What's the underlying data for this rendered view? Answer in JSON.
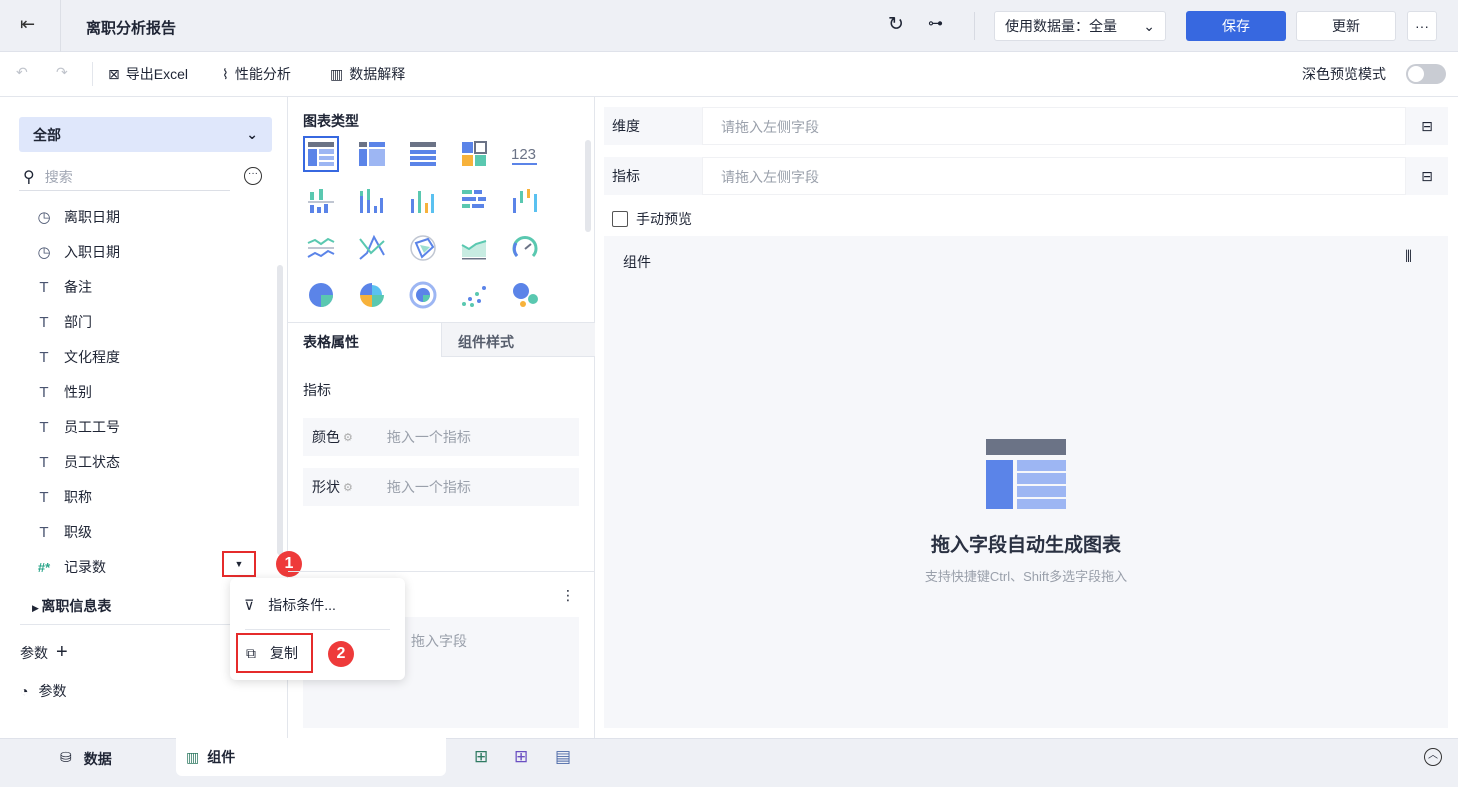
{
  "header": {
    "title": "离职分析报告",
    "data_amount": "使用数据量：全量",
    "save": "保存",
    "update": "更新",
    "more": "···"
  },
  "toolbar": {
    "export": "导出Excel",
    "perf": "性能分析",
    "explain": "数据解释",
    "dark_mode": "深色预览模式"
  },
  "left": {
    "scope": "全部",
    "search_placeholder": "搜索",
    "fields": [
      {
        "icon": "clock-icon",
        "label": "离职日期"
      },
      {
        "icon": "clock-icon",
        "label": "入职日期"
      },
      {
        "icon": "text-icon",
        "label": "备注"
      },
      {
        "icon": "text-icon",
        "label": "部门"
      },
      {
        "icon": "text-icon",
        "label": "文化程度"
      },
      {
        "icon": "text-icon",
        "label": "性别"
      },
      {
        "icon": "text-icon",
        "label": "员工工号"
      },
      {
        "icon": "text-icon",
        "label": "员工状态"
      },
      {
        "icon": "text-icon",
        "label": "职称"
      },
      {
        "icon": "text-icon",
        "label": "职级"
      },
      {
        "icon": "number-icon",
        "label": "记录数"
      }
    ],
    "table": "离职信息表",
    "params_label": "参数",
    "param_item": "参数"
  },
  "menu": {
    "items": [
      "指标条件...",
      "复制"
    ],
    "badges": [
      "1",
      "2"
    ]
  },
  "middle": {
    "chart_type_title": "图表类型",
    "chart_icons": [
      "table-chart",
      "crosstab-chart",
      "detail-table-chart",
      "kpi-grid-chart",
      "number-chart",
      "grouped-bar-chart",
      "stacked-bar-chart",
      "column-chart",
      "horizontal-bar-chart",
      "range-bar-chart",
      "multi-line-chart",
      "cross-line-chart",
      "radar-chart",
      "area-chart",
      "gauge-chart",
      "pie-chart",
      "rose-chart",
      "ring-chart",
      "scatter-chart",
      "bubble-chart"
    ],
    "tabs": [
      "表格属性",
      "组件样式"
    ],
    "indicator_label": "指标",
    "color_label": "颜色",
    "color_placeholder": "拖入一个指标",
    "shape_label": "形状",
    "shape_placeholder": "拖入一个指标",
    "drop_field": "拖入字段"
  },
  "right": {
    "dimension_label": "维度",
    "dimension_placeholder": "请拖入左侧字段",
    "metric_label": "指标",
    "metric_placeholder": "请拖入左侧字段",
    "manual_preview": "手动预览",
    "component_label": "组件",
    "empty_title": "拖入字段自动生成图表",
    "empty_hint": "支持快捷键Ctrl、Shift多选字段拖入"
  },
  "bottom": {
    "data_tab": "数据",
    "component_tab": "组件"
  },
  "colors": {
    "accent": "#3768e0",
    "blue": "#5b8ff9",
    "teal": "#5ac8b0",
    "orange": "#f7b23b",
    "red": "#ee3a3a"
  }
}
